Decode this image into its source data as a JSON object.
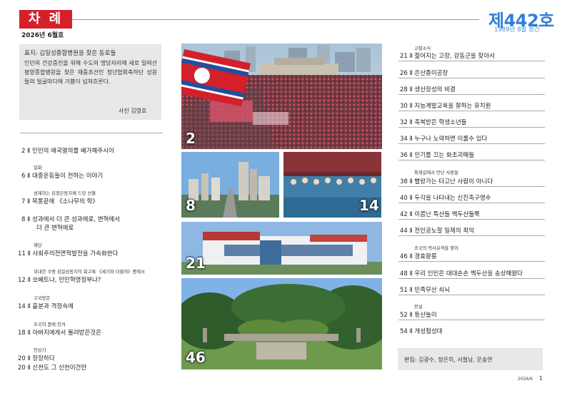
{
  "header": {
    "tab_label": "차 례",
    "issue_date": "2026년 6월호",
    "magazine_number": "제442호",
    "established": "1989년 8월 창간"
  },
  "cover": {
    "title": "표지: 김일성종합병원을 찾은 동로들",
    "text": "인민의 건강증진을 위해 수도의 명당자리에 새로 일떠선 평양종합병원을 찾은 재중조선인 청년협회축하단 성원들의 얼굴마다에 기쁨이 넘쳐흐른다.",
    "credit": "사진 김영호"
  },
  "toc_left": [
    {
      "category": "",
      "entry": "2 Ⅱ 인민의 애국열의를 배가해주시어",
      "continuation": ""
    },
    {
      "category": "일화",
      "entry": "6 Ⅱ 대중운동들이 전하는 이야기",
      "continuation": ""
    },
    {
      "category": "성재하는 김정은동지께 드린 선물",
      "entry": "7 Ⅱ 목통끝에 《소나무의 학》",
      "continuation": ""
    },
    {
      "category": "",
      "entry": "8 Ⅱ 성과에서 더 큰 성과에로, 변혁에서",
      "continuation": "더 큰 변혁에로"
    },
    {
      "category": "해당",
      "entry": "11 Ⅱ 사회주의전면적발전을 가속화한다",
      "continuation": ""
    },
    {
      "category": "위대한 수령 김일성동지의 회고록 《세기와 더불어》중에서",
      "entry": "12 Ⅱ 쏘베트냐, 인민혁명정부냐?",
      "continuation": ""
    },
    {
      "category": "고국방문",
      "entry": "14 Ⅱ 흩분과 격정속에",
      "continuation": ""
    },
    {
      "category": "조국의 품에 안겨",
      "entry": "18 Ⅱ 아버지에게서 물려받은것은",
      "continuation": ""
    },
    {
      "category": "인상기",
      "entry": "20 Ⅱ 장장하다",
      "continuation": ""
    },
    {
      "category": "",
      "entry": "20 Ⅱ 신천도 그 신천이건만",
      "continuation": ""
    }
  ],
  "toc_right": [
    {
      "category": "고향소식",
      "entry": "21 Ⅱ 젊어지는 고장, 강동군을 찾아서"
    },
    {
      "category": "",
      "entry": "26 Ⅱ 은산종이공장"
    },
    {
      "category": "",
      "entry": "28 Ⅱ 생산장성의 비결"
    },
    {
      "category": "",
      "entry": "30 Ⅱ 지능계발교육을 잘하는 유치원"
    },
    {
      "category": "",
      "entry": "32 Ⅱ 축복받은 학생소년들"
    },
    {
      "category": "",
      "entry": "34 Ⅱ 누구나 노력하면 이룰수 있다"
    },
    {
      "category": "",
      "entry": "36 Ⅱ 인기를 끄는 화초괴메들"
    },
    {
      "category": "취재길에서 만난 사람들",
      "entry": "38 Ⅱ 빨랑가는 타고난 사람이 아니다"
    },
    {
      "category": "",
      "entry": "40 Ⅱ 두각을 나타내는 신진축구명수"
    },
    {
      "category": "",
      "entry": "42 Ⅱ 이름난 특산들 백두산들쭉"
    },
    {
      "category": "",
      "entry": "44 Ⅱ 전인공노할 일제의 죄악"
    },
    {
      "category": "조국의 력사유적을 찾아",
      "entry": "46 Ⅱ 경효왕릉"
    },
    {
      "category": "",
      "entry": "48 Ⅱ 우리 인민은 대대손손 백두산을 송상해왔다"
    },
    {
      "category": "",
      "entry": "51 Ⅱ 민족무산 쇠뇌"
    },
    {
      "category": "전설",
      "entry": "52 Ⅱ 등산놀이"
    },
    {
      "category": "",
      "entry": "54 Ⅱ 개성첨성대"
    }
  ],
  "photos": {
    "p2": "2",
    "p8": "8",
    "p14": "14",
    "p21": "21",
    "p46": "46"
  },
  "footer": {
    "editors": "편집: 김광수, 정은히, 서철남, 문송연",
    "date": "2026/6",
    "page_number": "1"
  },
  "colors": {
    "brand_red": "#d3202a",
    "issue_blue": "#2f7fd6",
    "box_gray": "#e8e8e8"
  }
}
